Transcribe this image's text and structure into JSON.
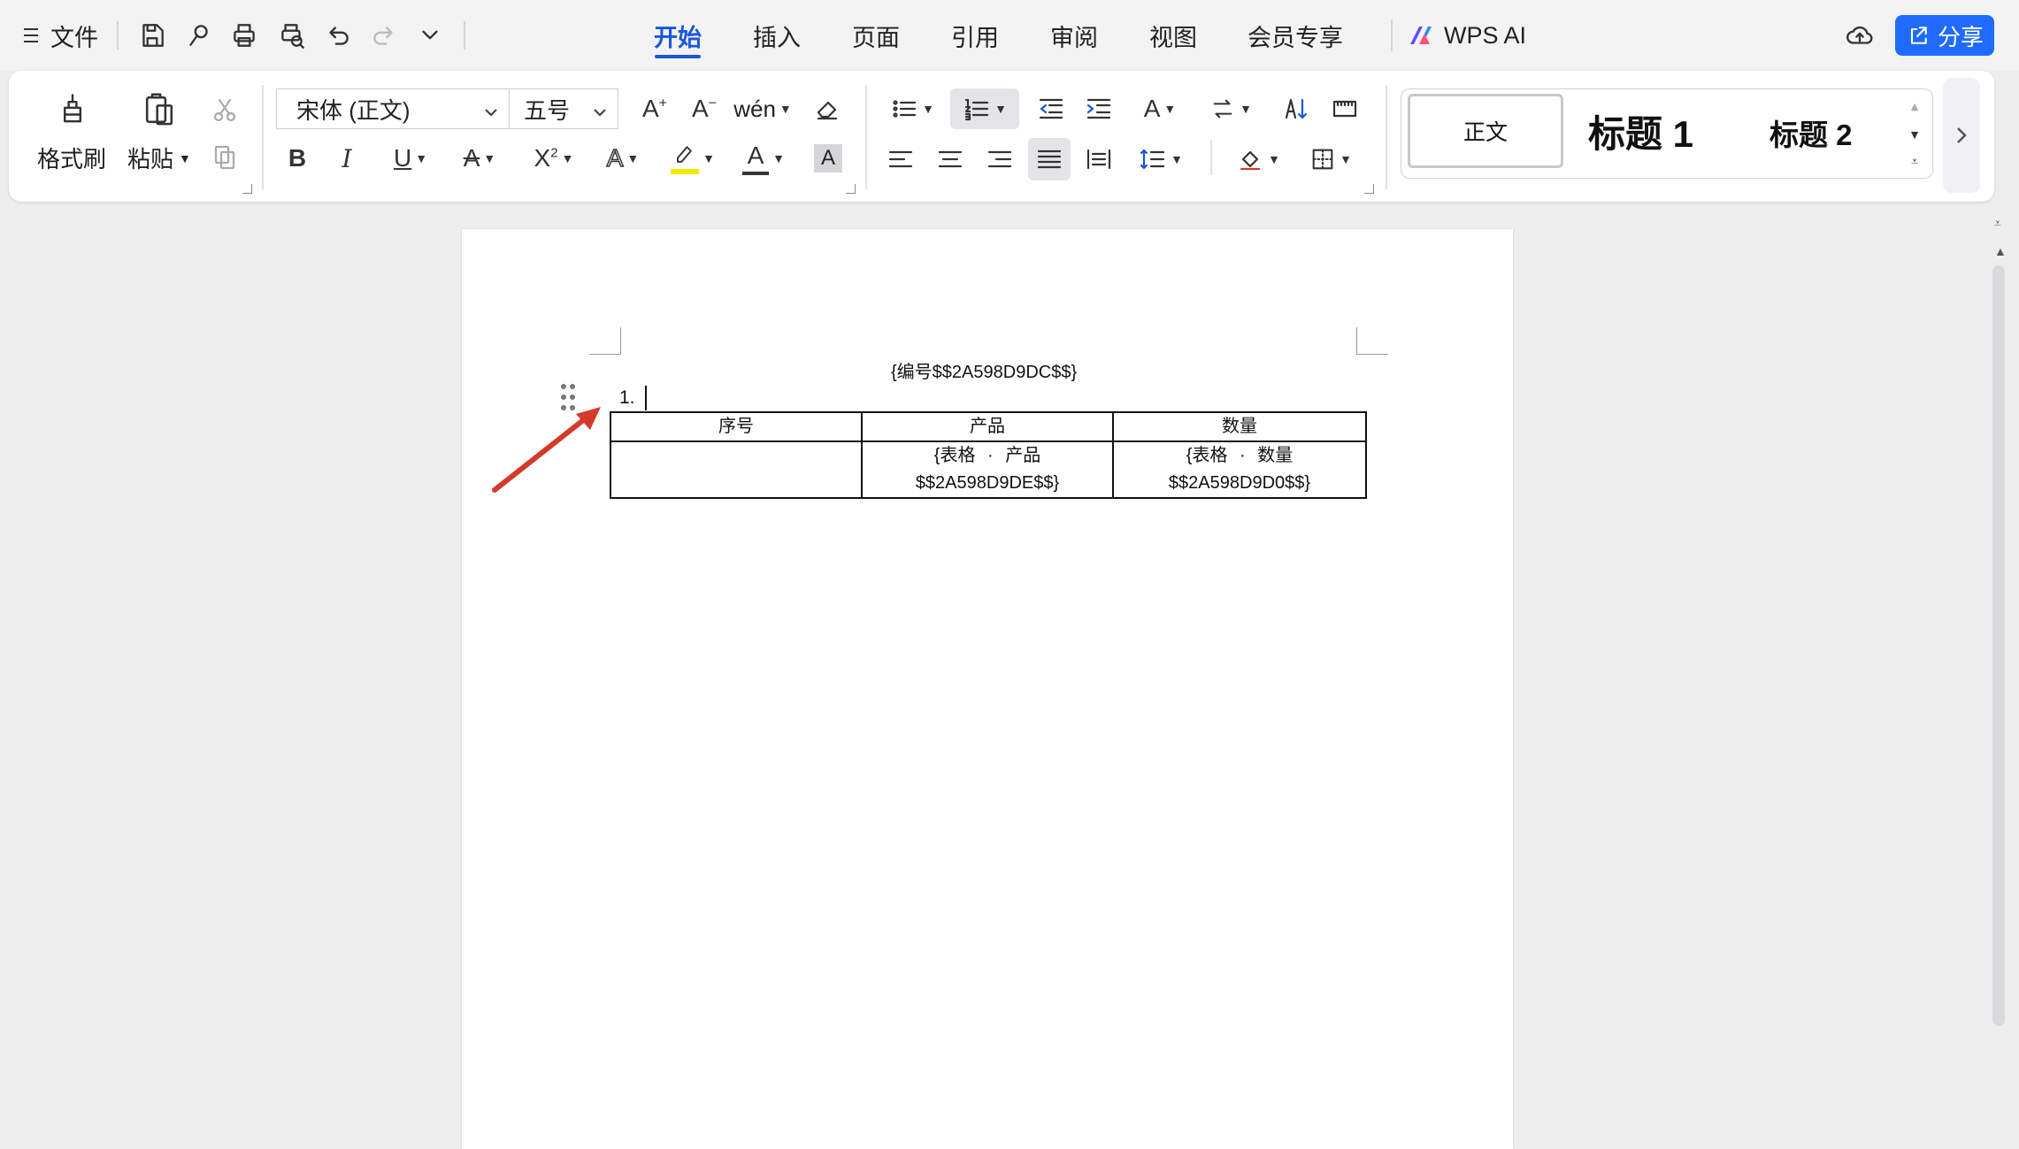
{
  "menu": {
    "file_label": "文件"
  },
  "tabs": [
    {
      "label": "开始",
      "active": true
    },
    {
      "label": "插入"
    },
    {
      "label": "页面"
    },
    {
      "label": "引用"
    },
    {
      "label": "审阅"
    },
    {
      "label": "视图"
    },
    {
      "label": "会员专享"
    }
  ],
  "wps_ai_label": "WPS AI",
  "share_label": "分享",
  "ribbon": {
    "format_painter_label": "格式刷",
    "paste_label": "粘贴",
    "font_name": "宋体 (正文)",
    "font_size": "五号",
    "styles": {
      "normal": "正文",
      "heading1": "标题 1",
      "heading2": "标题 2"
    }
  },
  "document": {
    "heading": "{编号$$2A598D9DC$$}",
    "list_number": "1.",
    "table": {
      "headers": [
        "序号",
        "产品",
        "数量"
      ],
      "rows": [
        [
          "",
          "{表格 · 产品 $$2A598D9DE$$}",
          "{表格 · 数量 $$2A598D9D0$$}"
        ]
      ]
    }
  },
  "colors": {
    "accent": "#1a56db",
    "share_button": "#1f6bff",
    "annotation_arrow": "#d43a2a",
    "highlight_yellow": "#f5e600"
  },
  "icons": [
    "hamburger-icon",
    "save-icon",
    "format-brush-small-icon",
    "print-icon",
    "print-preview-icon",
    "undo-icon",
    "redo-icon",
    "more-dropdown-icon",
    "cloud-upload-icon",
    "share-icon"
  ]
}
